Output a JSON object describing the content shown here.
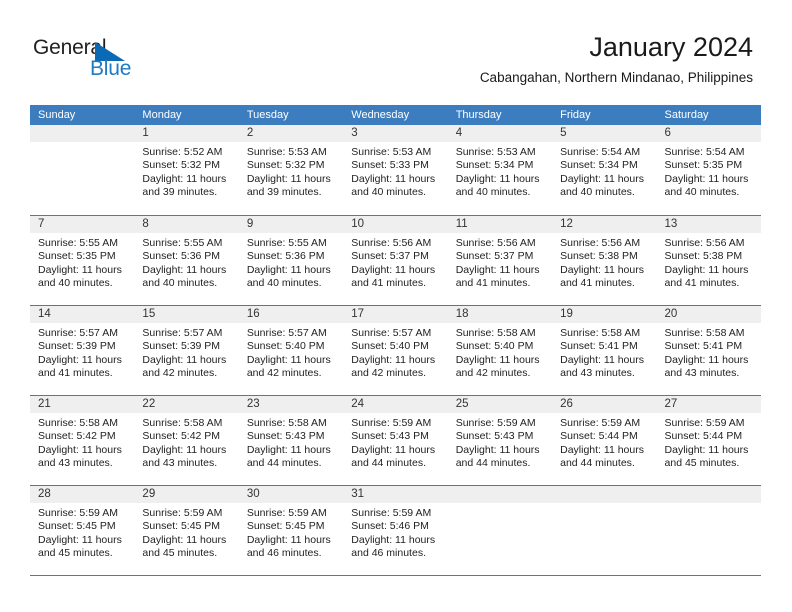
{
  "logo": {
    "word_one": "General",
    "word_two": "Blue",
    "triangle_icon": "triangle-icon"
  },
  "header": {
    "title": "January 2024",
    "subtitle": "Cabangahan, Northern Mindanao, Philippines"
  },
  "calendar": {
    "day_headers": [
      "Sunday",
      "Monday",
      "Tuesday",
      "Wednesday",
      "Thursday",
      "Friday",
      "Saturday"
    ],
    "accent_color": "#3c7dc0",
    "daynum_band_color": "#efefef",
    "weeks": [
      [
        {
          "day": "",
          "sunrise": "",
          "sunset": "",
          "daylight_line1": "",
          "daylight_line2": ""
        },
        {
          "day": "1",
          "sunrise": "Sunrise: 5:52 AM",
          "sunset": "Sunset: 5:32 PM",
          "daylight_line1": "Daylight: 11 hours",
          "daylight_line2": "and 39 minutes."
        },
        {
          "day": "2",
          "sunrise": "Sunrise: 5:53 AM",
          "sunset": "Sunset: 5:32 PM",
          "daylight_line1": "Daylight: 11 hours",
          "daylight_line2": "and 39 minutes."
        },
        {
          "day": "3",
          "sunrise": "Sunrise: 5:53 AM",
          "sunset": "Sunset: 5:33 PM",
          "daylight_line1": "Daylight: 11 hours",
          "daylight_line2": "and 40 minutes."
        },
        {
          "day": "4",
          "sunrise": "Sunrise: 5:53 AM",
          "sunset": "Sunset: 5:34 PM",
          "daylight_line1": "Daylight: 11 hours",
          "daylight_line2": "and 40 minutes."
        },
        {
          "day": "5",
          "sunrise": "Sunrise: 5:54 AM",
          "sunset": "Sunset: 5:34 PM",
          "daylight_line1": "Daylight: 11 hours",
          "daylight_line2": "and 40 minutes."
        },
        {
          "day": "6",
          "sunrise": "Sunrise: 5:54 AM",
          "sunset": "Sunset: 5:35 PM",
          "daylight_line1": "Daylight: 11 hours",
          "daylight_line2": "and 40 minutes."
        }
      ],
      [
        {
          "day": "7",
          "sunrise": "Sunrise: 5:55 AM",
          "sunset": "Sunset: 5:35 PM",
          "daylight_line1": "Daylight: 11 hours",
          "daylight_line2": "and 40 minutes."
        },
        {
          "day": "8",
          "sunrise": "Sunrise: 5:55 AM",
          "sunset": "Sunset: 5:36 PM",
          "daylight_line1": "Daylight: 11 hours",
          "daylight_line2": "and 40 minutes."
        },
        {
          "day": "9",
          "sunrise": "Sunrise: 5:55 AM",
          "sunset": "Sunset: 5:36 PM",
          "daylight_line1": "Daylight: 11 hours",
          "daylight_line2": "and 40 minutes."
        },
        {
          "day": "10",
          "sunrise": "Sunrise: 5:56 AM",
          "sunset": "Sunset: 5:37 PM",
          "daylight_line1": "Daylight: 11 hours",
          "daylight_line2": "and 41 minutes."
        },
        {
          "day": "11",
          "sunrise": "Sunrise: 5:56 AM",
          "sunset": "Sunset: 5:37 PM",
          "daylight_line1": "Daylight: 11 hours",
          "daylight_line2": "and 41 minutes."
        },
        {
          "day": "12",
          "sunrise": "Sunrise: 5:56 AM",
          "sunset": "Sunset: 5:38 PM",
          "daylight_line1": "Daylight: 11 hours",
          "daylight_line2": "and 41 minutes."
        },
        {
          "day": "13",
          "sunrise": "Sunrise: 5:56 AM",
          "sunset": "Sunset: 5:38 PM",
          "daylight_line1": "Daylight: 11 hours",
          "daylight_line2": "and 41 minutes."
        }
      ],
      [
        {
          "day": "14",
          "sunrise": "Sunrise: 5:57 AM",
          "sunset": "Sunset: 5:39 PM",
          "daylight_line1": "Daylight: 11 hours",
          "daylight_line2": "and 41 minutes."
        },
        {
          "day": "15",
          "sunrise": "Sunrise: 5:57 AM",
          "sunset": "Sunset: 5:39 PM",
          "daylight_line1": "Daylight: 11 hours",
          "daylight_line2": "and 42 minutes."
        },
        {
          "day": "16",
          "sunrise": "Sunrise: 5:57 AM",
          "sunset": "Sunset: 5:40 PM",
          "daylight_line1": "Daylight: 11 hours",
          "daylight_line2": "and 42 minutes."
        },
        {
          "day": "17",
          "sunrise": "Sunrise: 5:57 AM",
          "sunset": "Sunset: 5:40 PM",
          "daylight_line1": "Daylight: 11 hours",
          "daylight_line2": "and 42 minutes."
        },
        {
          "day": "18",
          "sunrise": "Sunrise: 5:58 AM",
          "sunset": "Sunset: 5:40 PM",
          "daylight_line1": "Daylight: 11 hours",
          "daylight_line2": "and 42 minutes."
        },
        {
          "day": "19",
          "sunrise": "Sunrise: 5:58 AM",
          "sunset": "Sunset: 5:41 PM",
          "daylight_line1": "Daylight: 11 hours",
          "daylight_line2": "and 43 minutes."
        },
        {
          "day": "20",
          "sunrise": "Sunrise: 5:58 AM",
          "sunset": "Sunset: 5:41 PM",
          "daylight_line1": "Daylight: 11 hours",
          "daylight_line2": "and 43 minutes."
        }
      ],
      [
        {
          "day": "21",
          "sunrise": "Sunrise: 5:58 AM",
          "sunset": "Sunset: 5:42 PM",
          "daylight_line1": "Daylight: 11 hours",
          "daylight_line2": "and 43 minutes."
        },
        {
          "day": "22",
          "sunrise": "Sunrise: 5:58 AM",
          "sunset": "Sunset: 5:42 PM",
          "daylight_line1": "Daylight: 11 hours",
          "daylight_line2": "and 43 minutes."
        },
        {
          "day": "23",
          "sunrise": "Sunrise: 5:58 AM",
          "sunset": "Sunset: 5:43 PM",
          "daylight_line1": "Daylight: 11 hours",
          "daylight_line2": "and 44 minutes."
        },
        {
          "day": "24",
          "sunrise": "Sunrise: 5:59 AM",
          "sunset": "Sunset: 5:43 PM",
          "daylight_line1": "Daylight: 11 hours",
          "daylight_line2": "and 44 minutes."
        },
        {
          "day": "25",
          "sunrise": "Sunrise: 5:59 AM",
          "sunset": "Sunset: 5:43 PM",
          "daylight_line1": "Daylight: 11 hours",
          "daylight_line2": "and 44 minutes."
        },
        {
          "day": "26",
          "sunrise": "Sunrise: 5:59 AM",
          "sunset": "Sunset: 5:44 PM",
          "daylight_line1": "Daylight: 11 hours",
          "daylight_line2": "and 44 minutes."
        },
        {
          "day": "27",
          "sunrise": "Sunrise: 5:59 AM",
          "sunset": "Sunset: 5:44 PM",
          "daylight_line1": "Daylight: 11 hours",
          "daylight_line2": "and 45 minutes."
        }
      ],
      [
        {
          "day": "28",
          "sunrise": "Sunrise: 5:59 AM",
          "sunset": "Sunset: 5:45 PM",
          "daylight_line1": "Daylight: 11 hours",
          "daylight_line2": "and 45 minutes."
        },
        {
          "day": "29",
          "sunrise": "Sunrise: 5:59 AM",
          "sunset": "Sunset: 5:45 PM",
          "daylight_line1": "Daylight: 11 hours",
          "daylight_line2": "and 45 minutes."
        },
        {
          "day": "30",
          "sunrise": "Sunrise: 5:59 AM",
          "sunset": "Sunset: 5:45 PM",
          "daylight_line1": "Daylight: 11 hours",
          "daylight_line2": "and 46 minutes."
        },
        {
          "day": "31",
          "sunrise": "Sunrise: 5:59 AM",
          "sunset": "Sunset: 5:46 PM",
          "daylight_line1": "Daylight: 11 hours",
          "daylight_line2": "and 46 minutes."
        },
        {
          "day": "",
          "sunrise": "",
          "sunset": "",
          "daylight_line1": "",
          "daylight_line2": ""
        },
        {
          "day": "",
          "sunrise": "",
          "sunset": "",
          "daylight_line1": "",
          "daylight_line2": ""
        },
        {
          "day": "",
          "sunrise": "",
          "sunset": "",
          "daylight_line1": "",
          "daylight_line2": ""
        }
      ]
    ]
  }
}
